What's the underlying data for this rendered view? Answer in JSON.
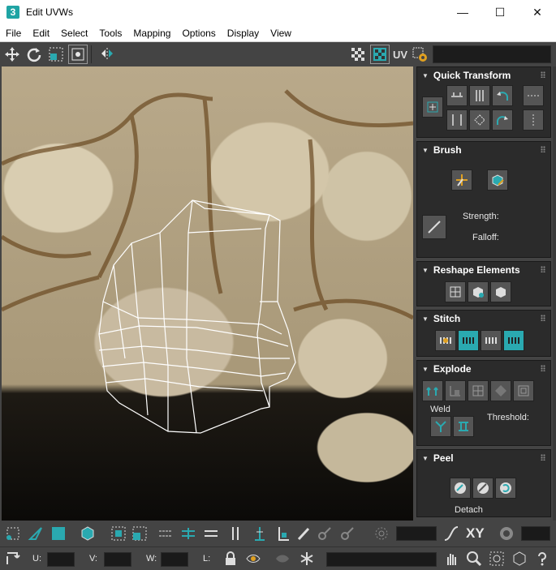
{
  "window": {
    "title": "Edit UVWs",
    "app_icon": "3",
    "minimize": "—",
    "maximize": "☐",
    "close": "✕"
  },
  "menu": [
    "File",
    "Edit",
    "Select",
    "Tools",
    "Mapping",
    "Options",
    "Display",
    "View"
  ],
  "toolbar": {
    "uv_label": "UV"
  },
  "panel": {
    "quick_transform": {
      "title": "Quick Transform"
    },
    "brush": {
      "title": "Brush",
      "strength_label": "Strength:",
      "falloff_label": "Falloff:"
    },
    "reshape": {
      "title": "Reshape Elements"
    },
    "stitch": {
      "title": "Stitch"
    },
    "explode": {
      "title": "Explode",
      "weld_label": "Weld",
      "threshold_label": "Threshold:"
    },
    "peel": {
      "title": "Peel",
      "detach_label": "Detach"
    }
  },
  "bottom": {
    "xy_label": "XY",
    "u_label": "U:",
    "v_label": "V:",
    "w_label": "W:",
    "l_label": "L:"
  },
  "colors": {
    "accent": "#2aa9b0",
    "panel_bg": "#2b2b2b",
    "toolbar_bg": "#444444"
  }
}
